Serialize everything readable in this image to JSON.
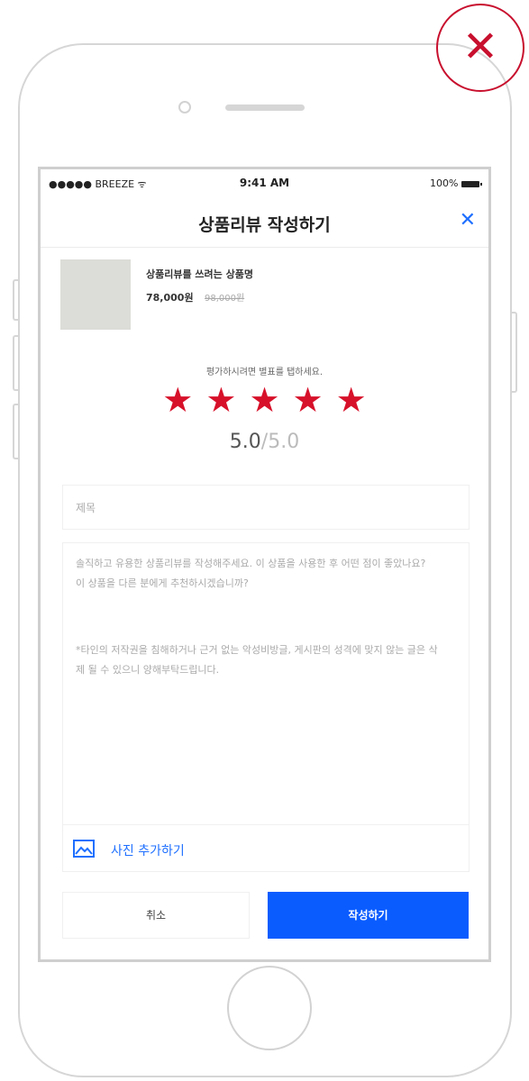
{
  "statusbar": {
    "carrier": "●●●●● BREEZE ᯤ",
    "time": "9:41 AM",
    "battery": "100%"
  },
  "header": {
    "title": "상품리뷰 작성하기",
    "close": "✕"
  },
  "product": {
    "name": "상품리뷰를 쓰려는 상품명",
    "price": "78,000원",
    "original_price": "98,000원"
  },
  "rating": {
    "guide": "평가하시려면 별표를 탭하세요.",
    "stars": [
      "★",
      "★",
      "★",
      "★",
      "★"
    ],
    "value": 5,
    "score": "5.0",
    "max": "/5.0"
  },
  "form": {
    "title_placeholder": "제목",
    "body_guide": "솔직하고 유용한 상품리뷰를 작성해주세요. 이 상품을 사용한 후 어떤 점이 좋았나요? 이 상품을 다른 분에게 추천하시겠습니까?",
    "body_notice": "*타인의 저작권을 침해하거나 근거 없는 악성비방글, 게시판의 성격에 맞지 않는 글은 삭제 될 수 있으니 양해부탁드립니다.",
    "add_photo": "사진 추가하기"
  },
  "buttons": {
    "cancel": "취소",
    "submit": "작성하기"
  },
  "overlay": {
    "close": "✕"
  },
  "colors": {
    "accent": "#0a5cff",
    "star": "#d7112a",
    "overlay": "#c8102e"
  }
}
